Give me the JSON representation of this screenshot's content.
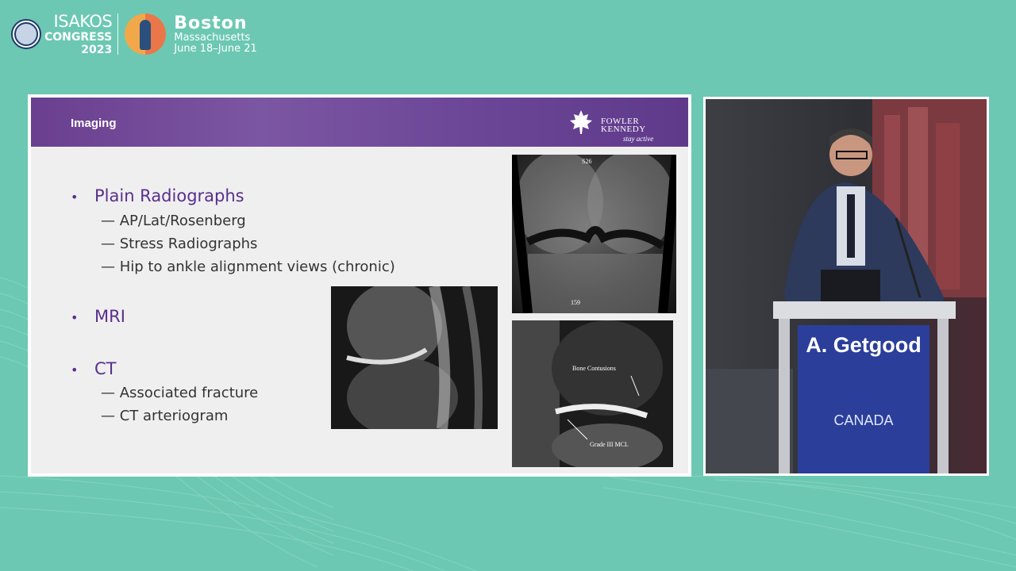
{
  "header": {
    "org_line1": "ISAKOS",
    "org_line2": "CONGRESS",
    "org_line3": "2023",
    "city": "Boston",
    "state": "Massachusetts",
    "dates": "June 18–June 21"
  },
  "slide": {
    "title": "Imaging",
    "logo_line1": "FOWLER",
    "logo_line2": "KENNEDY",
    "logo_tagline": "stay active",
    "bullets": [
      {
        "label": "Plain Radiographs",
        "subs": [
          "AP/Lat/Rosenberg",
          "Stress Radiographs",
          "Hip to ankle alignment views (chronic)"
        ]
      },
      {
        "label": "MRI",
        "subs": []
      },
      {
        "label": "CT",
        "subs": [
          "Associated fracture",
          "CT arteriogram"
        ]
      }
    ],
    "bullet_symbol": "•",
    "sub_symbol": "—",
    "image_labels": {
      "top_label1": "S26",
      "top_label2": "159",
      "bone_contusions": "Bone Contusions",
      "grade_mcl": "Grade III MCL"
    }
  },
  "video": {
    "speaker_name": "A. Getgood",
    "speaker_country": "CANADA"
  },
  "colors": {
    "background": "#6cc8b2",
    "slide_header": "#6a3f8f",
    "bullet_text": "#5a2f8b",
    "nameplate": "#2b3e9a"
  }
}
